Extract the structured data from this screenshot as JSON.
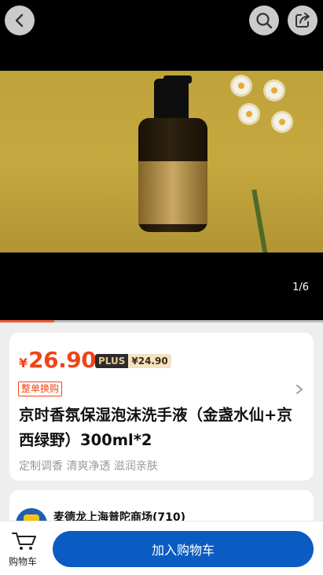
{
  "gallery": {
    "page_indicator": "1/6",
    "progress_fraction": 0.1667
  },
  "price": {
    "symbol": "¥",
    "value": "26.90",
    "plus_label": "PLUS",
    "plus_price": "¥24.90"
  },
  "promo": {
    "tag": "整单换购"
  },
  "product": {
    "title": "京时香氛保湿泡沫洗手液（金盏水仙+京西绿野）300ml*2",
    "subtitle": "定制调香 清爽净透 滋润亲肤"
  },
  "store": {
    "name": "麦德龙上海普陀商场(710)"
  },
  "bottom_bar": {
    "cart_label": "购物车",
    "add_to_cart": "加入购物车"
  },
  "colors": {
    "price": "#f04418",
    "primary_button": "#0b5cc2",
    "plus_dark": "#2b2b2b",
    "plus_gold": "#f3e3c3"
  }
}
